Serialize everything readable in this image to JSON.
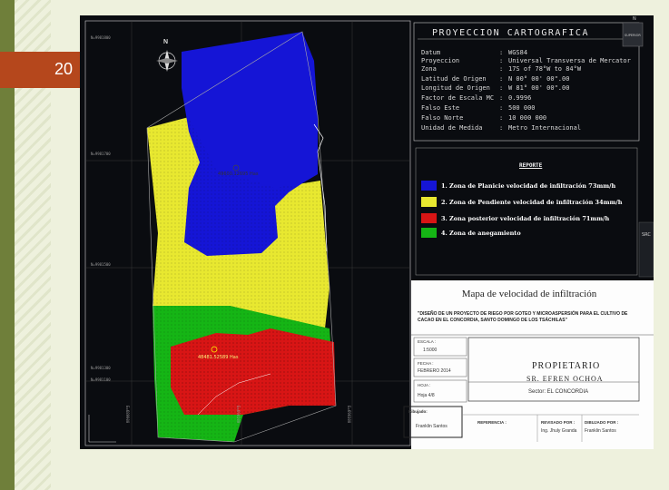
{
  "slide": {
    "number": "20"
  },
  "projection": {
    "title": "PROYECCION CARTOGRAFICA",
    "rows": [
      {
        "key": "Datum",
        "value": "WGS84"
      },
      {
        "key": "Proyeccion",
        "value": "Universal Transversa de Mercator"
      },
      {
        "key": "Zona",
        "value": "17S of 78°W to 84°W"
      },
      {
        "key": "Latitud de Origen",
        "value": "N 00° 00' 00\".00"
      },
      {
        "key": "Longitud de Origen",
        "value": "W 81° 00' 00\".00"
      },
      {
        "key": "Factor de Escala MC",
        "value": "0.9996"
      },
      {
        "key": "Falso Este",
        "value": "500 000"
      },
      {
        "key": "Falso Norte",
        "value": "10 000 000"
      },
      {
        "key": "Unidad de Medida",
        "value": "Metro Internacional"
      }
    ]
  },
  "report": {
    "title": "REPORTE",
    "items": [
      {
        "label": "1.  Zona de Planicie velocidad de infiltración 73mm/h",
        "color": "#1515d6"
      },
      {
        "label": "2.  Zona de Pendiente velocidad de infiltración 34mm/h",
        "color": "#e8e830"
      },
      {
        "label": "3. Zona posterior velocidad de infiltración 71mm/h",
        "color": "#d81515"
      },
      {
        "label": "4. Zona de anegamiento",
        "color": "#15b515"
      }
    ]
  },
  "titleblock": {
    "title": "Mapa de velocidad de infiltración",
    "description": "\"DISEÑO DE UN PROYECTO DE RIEGO POR GOTEO Y MICROASPERSIÓN PARA EL CULTIVO DE CACAO EN EL CONCORDIA, SANTO DOMINGO DE LOS TSÁCHILAS\"",
    "escala_label": "ESCALA :",
    "escala_value": "1:5000",
    "fecha_label": "FECHA :",
    "fecha_value": "FEBRERO 2014",
    "hoja_label": "HOJA :",
    "hoja_value": "Hoja 4/8",
    "owner_title": "PROPIETARIO",
    "owner_name": "SR. EFREN OCHOA",
    "owner_sector": "Sector: EL CONCORDIA",
    "drawn_label": "Dibujado:",
    "drawn_name": "Franklin Santos",
    "reference_label": "REFERENCIA :",
    "revisado_label": "REVISADO POR :",
    "revisado_name": "Ing. Jhuly Granda",
    "dibujado_label": "DIBUJADO POR :",
    "dibujado_name": "Franklin Santos"
  },
  "map": {
    "north": "N",
    "area_blue": "49600.12695 Has",
    "area_red": "48481.52589 Has",
    "coords_left": [
      "N=9981700",
      "N=9981500",
      "N=9981300",
      "N=9981100"
    ],
    "coords_top": [
      "N=9981800"
    ],
    "coords_bottom": [
      "E=689900",
      "E=690100",
      "E=690300"
    ]
  },
  "toolbar": {
    "top": "SUPERIOR",
    "side": "N",
    "side2": "SRC"
  }
}
